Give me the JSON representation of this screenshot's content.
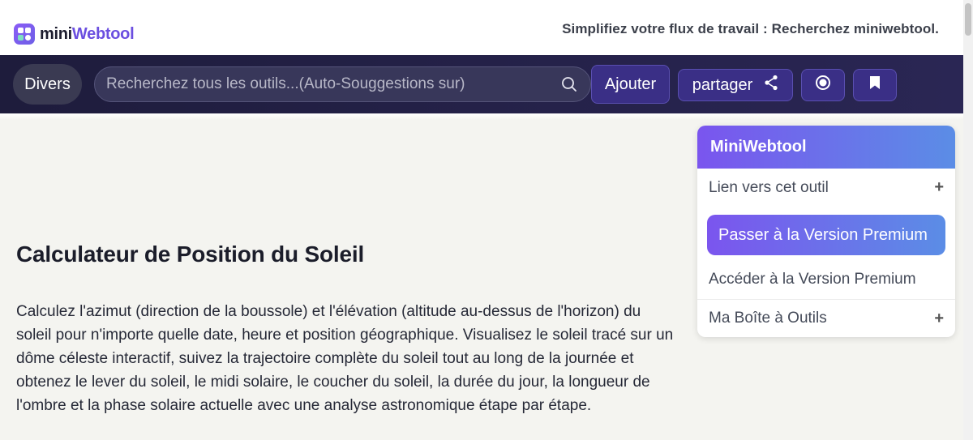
{
  "header": {
    "logo_part1": "mini",
    "logo_part2": "Webtool",
    "tagline": "Simplifiez votre flux de travail : Recherchez miniwebtool."
  },
  "nav": {
    "category_label": "Divers",
    "search_placeholder": "Recherchez tous les outils...(Auto-Souggestions sur)",
    "add_label": "Ajouter",
    "share_label": "partager"
  },
  "main": {
    "title": "Calculateur de Position du Soleil",
    "description": "Calculez l'azimut (direction de la boussole) et l'élévation (altitude au-dessus de l'horizon) du soleil pour n'importe quelle date, heure et position géographique. Visualisez le soleil tracé sur un dôme céleste interactif, suivez la trajectoire complète du soleil tout au long de la journée et obtenez le lever du soleil, le midi solaire, le coucher du soleil, la durée du jour, la longueur de l'ombre et la phase solaire actuelle avec une analyse astronomique étape par étape."
  },
  "sidebar": {
    "title": "MiniWebtool",
    "link_label": "Lien vers cet outil",
    "premium_button": "Passer à la Version Premium",
    "access_premium": "Accéder à la Version Premium",
    "toolbox_label": "Ma Boîte à Outils",
    "expand_symbol": "+"
  }
}
